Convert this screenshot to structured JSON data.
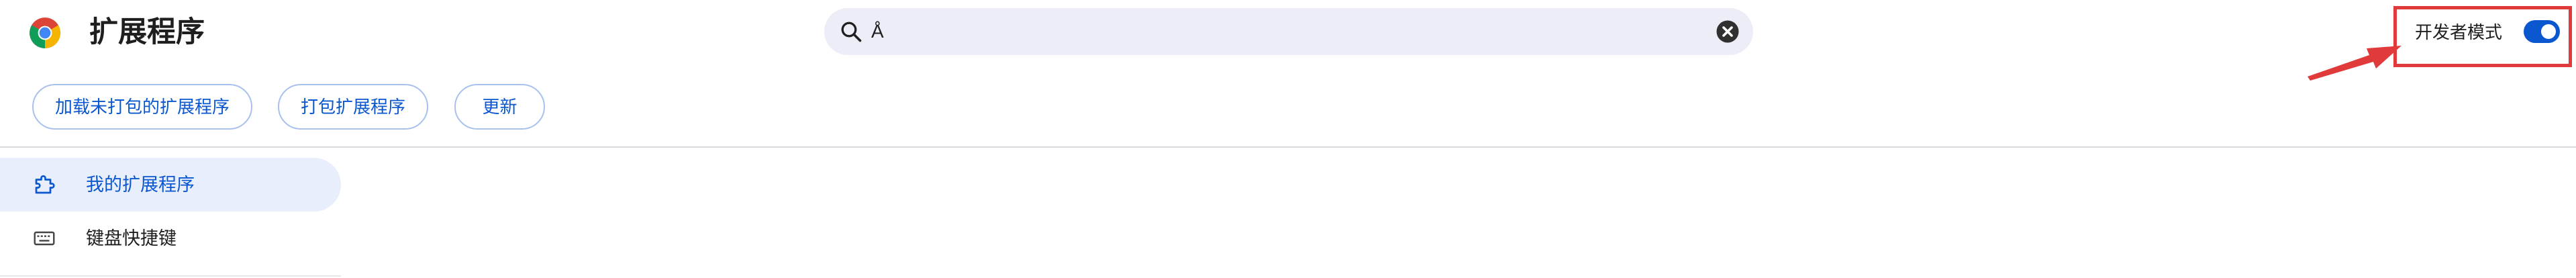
{
  "header": {
    "title": "扩展程序",
    "logo_icon": "chrome-logo-icon"
  },
  "search": {
    "value": "Å",
    "icon": "search-icon",
    "clear_icon": "clear-icon"
  },
  "developer_mode": {
    "label": "开发者模式",
    "enabled": true,
    "highlight_color": "#e03a3a"
  },
  "toolbar": {
    "load_unpacked_label": "加载未打包的扩展程序",
    "pack_label": "打包扩展程序",
    "update_label": "更新"
  },
  "sidebar": {
    "items": [
      {
        "label": "我的扩展程序",
        "icon": "puzzle-icon",
        "active": true
      },
      {
        "label": "键盘快捷键",
        "icon": "keyboard-icon",
        "active": false
      }
    ]
  },
  "colors": {
    "accent": "#0b57d0",
    "search_bg": "#ecedf6",
    "active_nav_bg": "#e8eefc"
  }
}
